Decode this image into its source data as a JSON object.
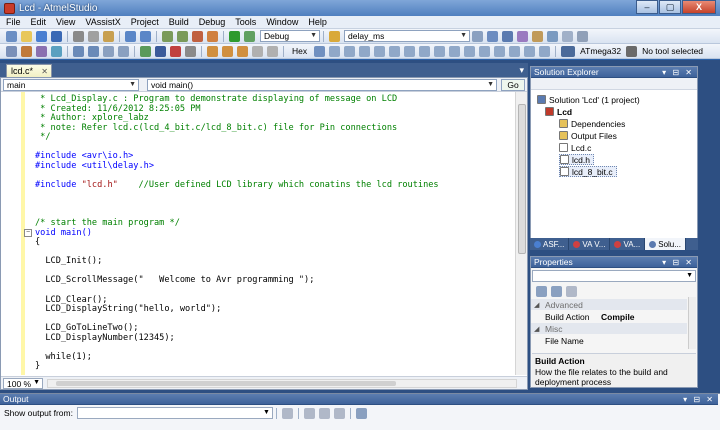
{
  "window": {
    "title": "Lcd - AtmelStudio",
    "controls": [
      "–",
      "▢",
      "X"
    ]
  },
  "menu": [
    "File",
    "Edit",
    "View",
    "VAssistX",
    "Project",
    "Build",
    "Debug",
    "Tools",
    "Window",
    "Help"
  ],
  "toolbar": {
    "config_value": "Debug",
    "find_value": "delay_ms",
    "hex_label": "Hex",
    "device_label": "ATmega32",
    "tool_label": "No tool selected"
  },
  "editor": {
    "tab_label": "lcd.c*",
    "scope_combo": "main",
    "function_combo": "void main()",
    "go_label": "Go",
    "zoom": "100 %",
    "lines": [
      {
        "text": " * Lcd_Display.c : Program to demonstrate displaying of message on LCD",
        "cls": "c-comment"
      },
      {
        "text": " * Created: 11/6/2012 8:25:05 PM",
        "cls": "c-comment"
      },
      {
        "text": " * Author: xplore_labz",
        "cls": "c-comment"
      },
      {
        "text": " * note: Refer lcd.c(lcd_4_bit.c/lcd_8_bit.c) file for Pin connections",
        "cls": "c-comment"
      },
      {
        "text": " */",
        "cls": "c-comment"
      },
      {
        "text": "",
        "cls": "c-plain"
      },
      {
        "text": "#include <avr\\io.h>",
        "cls": "c-kw"
      },
      {
        "text": "#include <util\\delay.h>",
        "cls": "c-kw"
      },
      {
        "text": "",
        "cls": "c-plain"
      },
      {
        "text": "#include \"lcd.h\"    //User defined LCD library which conatins the lcd routines",
        "cls": "c-mixed"
      },
      {
        "text": "",
        "cls": "c-plain"
      },
      {
        "text": "",
        "cls": "c-plain"
      },
      {
        "text": "",
        "cls": "c-plain"
      },
      {
        "text": "/* start the main program */",
        "cls": "c-comment"
      },
      {
        "text": "void main()",
        "cls": "c-kw"
      },
      {
        "text": "{",
        "cls": "c-plain"
      },
      {
        "text": "",
        "cls": "c-plain"
      },
      {
        "text": "  LCD_Init();",
        "cls": "c-plain"
      },
      {
        "text": "",
        "cls": "c-plain"
      },
      {
        "text": "  LCD_ScrollMessage(\"   Welcome to Avr programming \");",
        "cls": "c-plain"
      },
      {
        "text": "",
        "cls": "c-plain"
      },
      {
        "text": "  LCD_Clear();",
        "cls": "c-plain"
      },
      {
        "text": "  LCD_DisplayString(\"hello, world\");",
        "cls": "c-plain"
      },
      {
        "text": "",
        "cls": "c-plain"
      },
      {
        "text": "  LCD_GoToLineTwo();",
        "cls": "c-plain"
      },
      {
        "text": "  LCD_DisplayNumber(12345);",
        "cls": "c-plain"
      },
      {
        "text": "",
        "cls": "c-plain"
      },
      {
        "text": "  while(1);",
        "cls": "c-plain"
      },
      {
        "text": "}",
        "cls": "c-plain"
      }
    ]
  },
  "solution_explorer": {
    "title": "Solution Explorer",
    "items": [
      {
        "label": "Solution 'Lcd' (1 project)",
        "icon": "solution-icon"
      },
      {
        "label": "Lcd",
        "icon": "project-icon",
        "bold": true
      },
      {
        "label": "Dependencies",
        "icon": "folder-icon"
      },
      {
        "label": "Output Files",
        "icon": "folder-icon"
      },
      {
        "label": "Lcd.c",
        "icon": "c-file-icon"
      },
      {
        "label": "lcd.h",
        "icon": "h-file-icon"
      },
      {
        "label": "lcd_8_bit.c",
        "icon": "c-file-icon"
      }
    ],
    "tabs": [
      "ASF...",
      "VA V...",
      "VA...",
      "Solu..."
    ]
  },
  "properties": {
    "title": "Properties",
    "rows": [
      {
        "key": "Advanced",
        "value": "",
        "category": true
      },
      {
        "key": "Build Action",
        "value": "Compile",
        "category": false
      },
      {
        "key": "Misc",
        "value": "",
        "category": true
      },
      {
        "key": "File Name",
        "value": "",
        "category": false
      }
    ],
    "desc_title": "Build Action",
    "desc_text": "How the file relates to the build and deployment process"
  },
  "output": {
    "title": "Output",
    "show_label": "Show output from:"
  }
}
